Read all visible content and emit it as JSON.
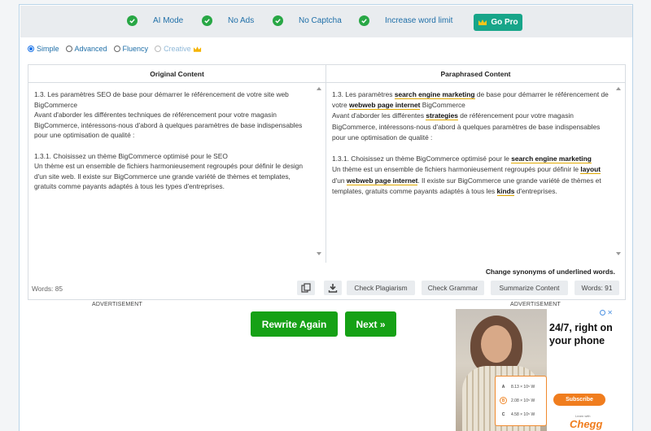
{
  "features": [
    {
      "label": "AI Mode"
    },
    {
      "label": "No Ads"
    },
    {
      "label": "No Captcha"
    },
    {
      "label": "Increase word limit"
    }
  ],
  "go_pro_label": "Go Pro",
  "modes": [
    {
      "label": "Simple",
      "checked": true
    },
    {
      "label": "Advanced",
      "checked": false
    },
    {
      "label": "Fluency",
      "checked": false
    },
    {
      "label": "Creative",
      "checked": false,
      "disabled": true,
      "premium": true
    }
  ],
  "original": {
    "heading": "Original Content",
    "paragraphs": [
      "1.3. Les paramètres SEO de base pour démarrer le référencement de votre site web BigCommerce",
      "Avant d'aborder les différentes techniques de référencement pour votre magasin BigCommerce, intéressons-nous d'abord à quelques paramètres de base indispensables pour une optimisation de qualité :",
      "",
      "1.3.1. Choisissez un thème BigCommerce optimisé pour le SEO",
      "Un thème est un ensemble de fichiers harmonieusement regroupés pour définir le design d'un site web. Il existe sur BigCommerce une grande variété de thèmes et templates, gratuits comme payants adaptés à tous les types d'entreprises."
    ]
  },
  "paraphrased": {
    "heading": "Paraphrased Content",
    "paragraphs": [
      [
        {
          "t": "1.3. Les paramètres "
        },
        {
          "t": "search engine marketing",
          "s": true
        },
        {
          "t": " de base pour démarrer le référencement de votre "
        },
        {
          "t": "webweb page internet",
          "s": true
        },
        {
          "t": " BigCommerce"
        }
      ],
      [
        {
          "t": "Avant d'aborder les différentes "
        },
        {
          "t": "strategies",
          "s": true
        },
        {
          "t": " de référencement pour votre magasin BigCommerce, intéressons-nous d'abord à quelques paramètres de base indispensables pour une optimisation de qualité :"
        }
      ],
      [],
      [
        {
          "t": "1.3.1. Choisissez un thème BigCommerce optimisé pour le "
        },
        {
          "t": "search engine marketing",
          "s": true
        }
      ],
      [
        {
          "t": "Un thème est un ensemble de fichiers harmonieusement regroupés pour définir le "
        },
        {
          "t": "layout",
          "s": true
        },
        {
          "t": " d'un "
        },
        {
          "t": "webweb page internet",
          "s": true
        },
        {
          "t": ". Il existe sur BigCommerce une grande variété de thèmes et templates, gratuits comme payants adaptés à tous les "
        },
        {
          "t": "kinds",
          "s": true
        },
        {
          "t": " d'entreprises."
        }
      ]
    ],
    "note": "Change synonyms of underlined words."
  },
  "toolbar": {
    "words_left": "Words: 85",
    "check_plagiarism": "Check Plagiarism",
    "check_grammar": "Check Grammar",
    "summarize": "Summarize Content",
    "words_right": "Words: 91"
  },
  "ad_label": "ADVERTISEMENT",
  "rewrite_label": "Rewrite Again",
  "next_label": "Next »",
  "ad": {
    "headline": "24/7, right on your phone",
    "subscribe": "Subscribe",
    "brand": "Chegg",
    "brand_tag": "Learn with",
    "options": [
      {
        "letter": "A",
        "text": "8.13 × 10⁵ W"
      },
      {
        "letter": "B",
        "text": "2.08 × 10⁵ W",
        "selected": true
      },
      {
        "letter": "C",
        "text": "4.58 × 10⁵ W"
      }
    ]
  },
  "colors": {
    "accent_green": "#28a745",
    "go_pro": "#17a589",
    "primary_button": "#16a116",
    "link_blue": "#1f6fa8",
    "underline": "#e0a800"
  }
}
